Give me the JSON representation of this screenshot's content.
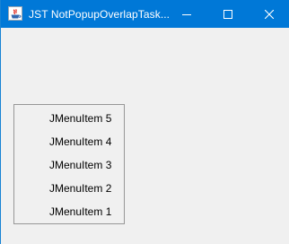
{
  "window": {
    "title": "JST NotPopupOverlapTask...",
    "icon": "java-app-icon",
    "controls": {
      "minimize": "minimize-icon",
      "maximize": "maximize-icon",
      "close": "close-icon"
    },
    "accent_color": "#0078d7"
  },
  "popup_menu": {
    "items": [
      {
        "label": "JMenuItem 5"
      },
      {
        "label": "JMenuItem 4"
      },
      {
        "label": "JMenuItem 3"
      },
      {
        "label": "JMenuItem 2"
      },
      {
        "label": "JMenuItem 1"
      }
    ]
  }
}
